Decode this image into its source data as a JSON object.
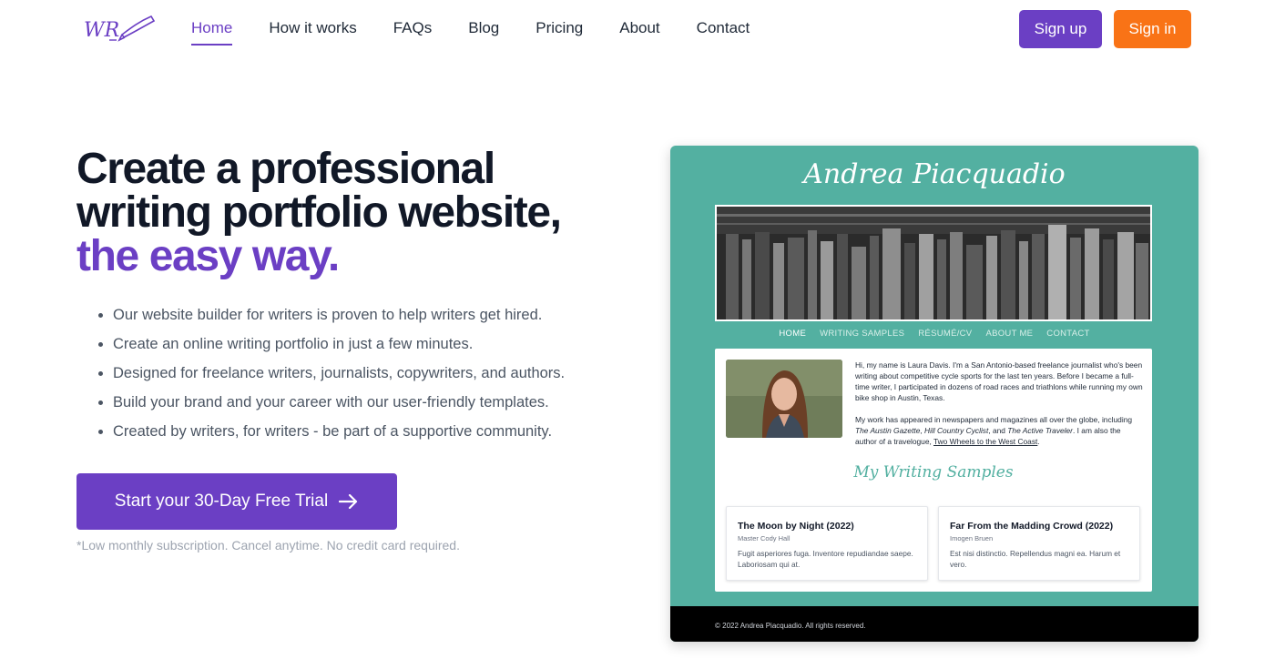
{
  "nav": {
    "items": [
      {
        "label": "Home",
        "active": true
      },
      {
        "label": "How it works"
      },
      {
        "label": "FAQs"
      },
      {
        "label": "Blog"
      },
      {
        "label": "Pricing"
      },
      {
        "label": "About"
      },
      {
        "label": "Contact"
      }
    ],
    "signup_label": "Sign up",
    "signin_label": "Sign in"
  },
  "hero": {
    "title_line1": "Create a professional",
    "title_line2": "writing portfolio website,",
    "title_highlight": "the easy way.",
    "bullets": [
      "Our website builder for writers is proven to help writers get hired.",
      "Create an online writing portfolio in just a few minutes.",
      "Designed for freelance writers, journalists, copywriters, and authors.",
      "Build your brand and your career with our user-friendly templates.",
      "Created by writers, for writers - be part of a supportive community."
    ],
    "cta_label": "Start your 30-Day Free Trial",
    "fineprint": "*Low monthly subscription. Cancel anytime. No credit card required."
  },
  "preview": {
    "site_name": "Andrea Piacquadio",
    "nav": [
      "HOME",
      "WRITING SAMPLES",
      "RÉSUMÉ/CV",
      "ABOUT ME",
      "CONTACT"
    ],
    "bio_p1": "Hi, my name is Laura Davis. I'm a San Antonio-based freelance journalist who's been writing about competitive cycle sports for the last ten years. Before I became a full-time writer, I participated in dozens of road races and triathlons while running my own bike shop in Austin, Texas.",
    "bio_p2_pre": "My work has appeared in newspapers and magazines all over the globe, including ",
    "bio_p2_pub1": "The Austin Gazette",
    "bio_p2_sep1": ", ",
    "bio_p2_pub2": "Hill Country Cyclist",
    "bio_p2_sep2": ", and ",
    "bio_p2_pub3": "The Active Traveler",
    "bio_p2_mid": ". I am also the author of a travelogue, ",
    "bio_p2_book": "Two Wheels to the West Coast",
    "bio_p2_end": ".",
    "samples_title": "My Writing Samples",
    "samples": [
      {
        "title": "The Moon by Night (2022)",
        "author": "Master Cody Hall",
        "excerpt": "Fugit asperiores fuga. Inventore repudiandae saepe. Laboriosam qui at."
      },
      {
        "title": "Far From the Madding Crowd (2022)",
        "author": "Imogen Bruen",
        "excerpt": "Est nisi distinctio. Repellendus magni ea. Harum et vero."
      }
    ],
    "footer": "© 2022 Andrea Piacquadio. All rights reserved."
  },
  "colors": {
    "brand_purple": "#6b3fc4",
    "brand_orange": "#f97316",
    "preview_teal": "#53b0a1"
  },
  "icons": {
    "logo": "wr-pen-logo",
    "cta_arrow": "arrow-right-icon"
  }
}
